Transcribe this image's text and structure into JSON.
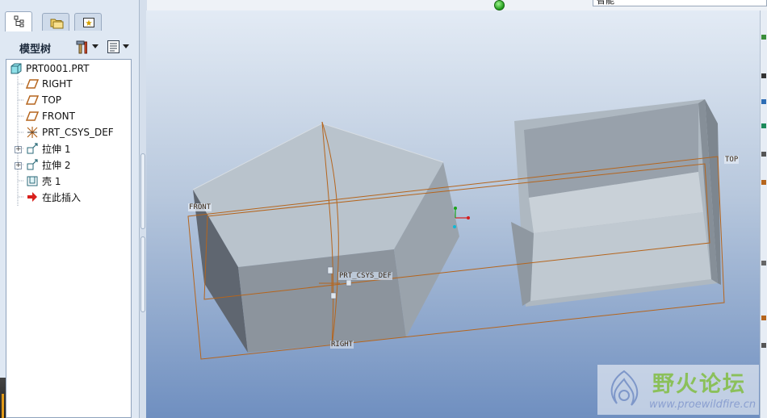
{
  "top_strip": {
    "search_mode_text": "智能"
  },
  "model_tree": {
    "title": "模型树",
    "items": [
      {
        "label": "PRT0001.PRT",
        "icon": "part-icon",
        "expandable": false
      },
      {
        "label": "RIGHT",
        "icon": "datum-plane-icon",
        "expandable": false
      },
      {
        "label": "TOP",
        "icon": "datum-plane-icon",
        "expandable": false
      },
      {
        "label": "FRONT",
        "icon": "datum-plane-icon",
        "expandable": false
      },
      {
        "label": "PRT_CSYS_DEF",
        "icon": "coordinate-system-icon",
        "expandable": false
      },
      {
        "label": "拉伸 1",
        "icon": "extrude-icon",
        "expandable": true
      },
      {
        "label": "拉伸 2",
        "icon": "extrude-icon",
        "expandable": true
      },
      {
        "label": "壳 1",
        "icon": "shell-icon",
        "expandable": false
      },
      {
        "label": "在此插入",
        "icon": "insert-here-arrow-icon",
        "expandable": false
      }
    ]
  },
  "viewport": {
    "datum_labels": {
      "front": "FRONT",
      "top": "TOP",
      "right": "RIGHT",
      "csys": "PRT_CSYS_DEF"
    }
  },
  "watermark": {
    "title": "野火论坛",
    "url": "www.proewildfire.cn"
  },
  "colors": {
    "datum": "#b5651d",
    "model_face": "#a9b3bd",
    "background_bottom": "#6f8fc0"
  }
}
